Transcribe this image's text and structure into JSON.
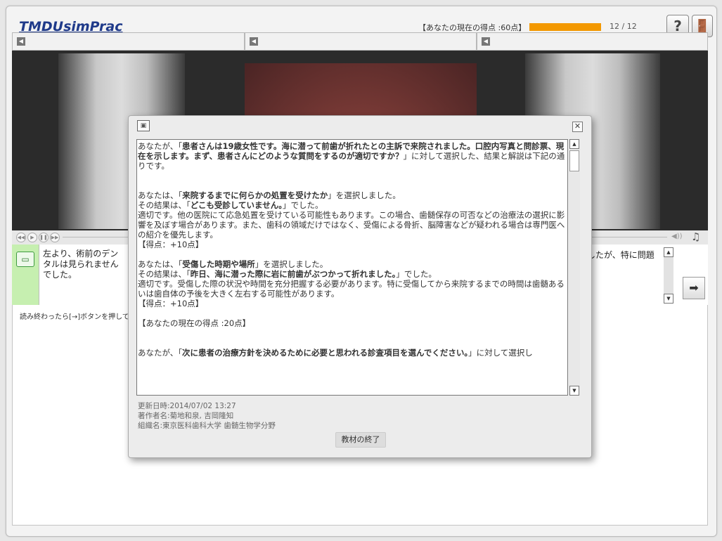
{
  "header": {
    "logo": "TMDUsimPrac",
    "score_text": "【あなたの現在の得点 :60点】",
    "progress": 1.0,
    "counter": "12 / 12",
    "help_label": "?",
    "exit_label": "🚪"
  },
  "panes": [
    {
      "type": "xray"
    },
    {
      "type": "photo"
    },
    {
      "type": "xray"
    }
  ],
  "info": {
    "left_text": "左より、術前のデンタルは見られませんでした。",
    "right_text": "したが、特に問題",
    "next_label": "➡"
  },
  "instruction": "読み終わったら[→]ボタンを押して",
  "dialog": {
    "p1_prefix": "あなたが、「",
    "p1_bold": "患者さんは19歳女性です。海に潜って前歯が折れたとの主訴で来院されました。口腔内写真と問診票、現在を示します。まず、患者さんにどのような質問をするのが適切ですか？",
    "p1_suffix": "」に対して選択した、結果と解説は下記の通りです。",
    "a1_prefix": "あなたは、「",
    "a1_bold": "来院するまでに何らかの処置を受けたか",
    "a1_suffix": "」を選択しました。",
    "r1_prefix": "その結果は、「",
    "r1_bold": "どこも受診していません。",
    "r1_suffix": "」でした。",
    "e1": "適切です。他の医院にて応急処置を受けている可能性もあります。この場合、歯髄保存の可否などの治療法の選択に影響を及ぼす場合があります。また、歯科の領域だけではなく、受傷による骨折、脳障害などが疑われる場合は専門医への紹介を優先します。",
    "s1": "【得点：+10点】",
    "a2_prefix": "あなたは、「",
    "a2_bold": "受傷した時期や場所",
    "a2_suffix": "」を選択しました。",
    "r2_prefix": "その結果は、「",
    "r2_bold": "昨日、海に潜った際に岩に前歯がぶつかって折れました。",
    "r2_suffix": "」でした。",
    "e2": "適切です。受傷した際の状況や時間を充分把握する必要があります。特に受傷してから来院するまでの時間は歯髄あるいは歯自体の予後を大きく左右する可能性があります。",
    "s2": "【得点：+10点】",
    "current": "【あなたの現在の得点 :20点】",
    "p2_prefix": "あなたが、「",
    "p2_bold": "次に患者の治療方針を決めるために必要と思われる診査項目を選んでください。",
    "p2_suffix": "」に対して選択し",
    "updated": "更新日時:2014/07/02 13:27",
    "author": "著作者名:菊地和泉, 吉岡隆知",
    "org": "組織名:東京医科歯科大学 歯髄生物学分野",
    "end_button": "教材の終了",
    "close_label": "✕"
  }
}
